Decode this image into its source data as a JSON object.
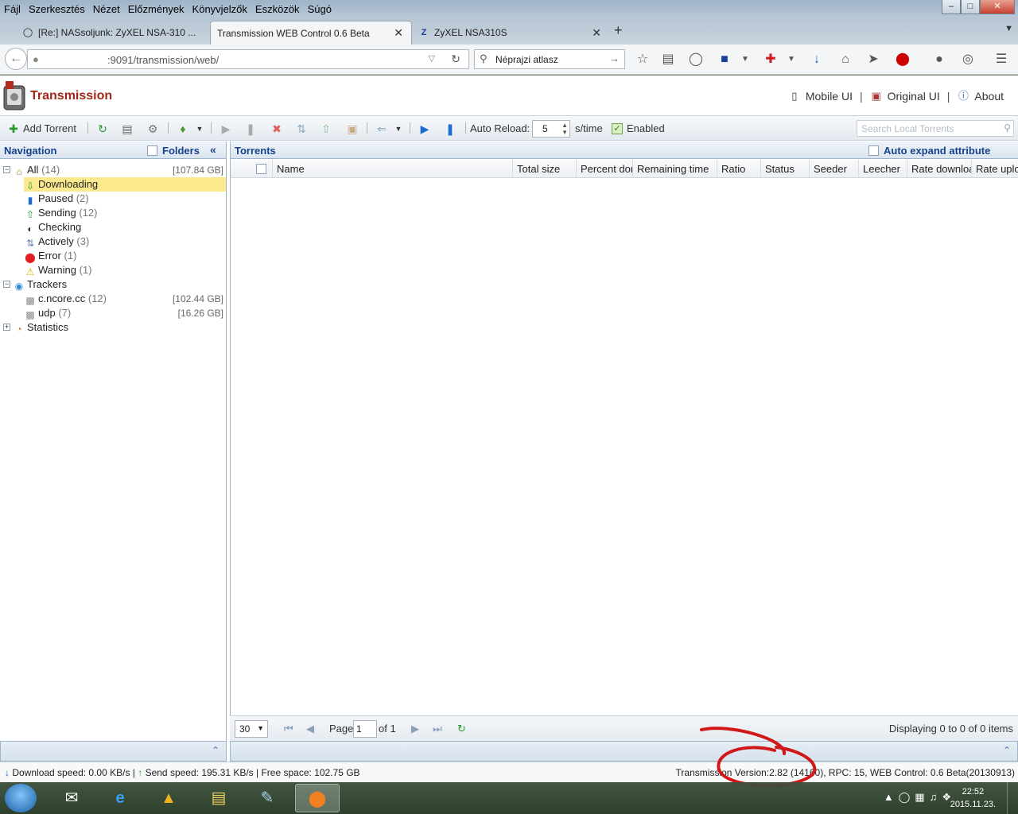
{
  "menu": [
    "Fájl",
    "Szerkesztés",
    "Nézet",
    "Előzmények",
    "Könyvjelzők",
    "Eszközök",
    "Súgó"
  ],
  "tabs": [
    {
      "label": "[Re:] NASsoljunk: ZyXEL NSA-310 ...",
      "icon": "chat-icon"
    },
    {
      "label": "Transmission WEB Control 0.6 Beta",
      "icon": ""
    },
    {
      "label": "ZyXEL NSA310S",
      "icon": "zyxel-icon"
    }
  ],
  "address": {
    "url": ":9091/transmission/web/"
  },
  "search": {
    "query": "Néprajzi atlasz"
  },
  "app": {
    "title": "Transmission"
  },
  "header_links": {
    "mobile": "Mobile UI",
    "original": "Original UI",
    "about": "About"
  },
  "toolbar": {
    "add_torrent": "Add Torrent",
    "auto_reload_label": "Auto Reload:",
    "auto_reload_value": "5",
    "auto_reload_unit": "s/time",
    "enabled_label": "Enabled",
    "search_placeholder": "Search Local Torrents"
  },
  "nav": {
    "title": "Navigation",
    "folders_label": "Folders",
    "all": {
      "label": "All",
      "count": "(14)",
      "size": "[107.84 GB]"
    },
    "items": [
      {
        "label": "Downloading",
        "count": ""
      },
      {
        "label": "Paused",
        "count": "(2)"
      },
      {
        "label": "Sending",
        "count": "(12)"
      },
      {
        "label": "Checking",
        "count": ""
      },
      {
        "label": "Actively",
        "count": "(3)"
      },
      {
        "label": "Error",
        "count": "(1)"
      },
      {
        "label": "Warning",
        "count": "(1)"
      }
    ],
    "trackers": {
      "label": "Trackers"
    },
    "tracker_items": [
      {
        "label": "c.ncore.cc",
        "count": "(12)",
        "size": "[102.44 GB]"
      },
      {
        "label": "udp",
        "count": "(7)",
        "size": "[16.26 GB]"
      }
    ],
    "statistics": {
      "label": "Statistics"
    }
  },
  "torrents": {
    "title": "Torrents",
    "auto_expand_label": "Auto expand attribute",
    "columns": [
      "Name",
      "Total size",
      "Percent done",
      "Remaining time",
      "Ratio",
      "Status",
      "Seeder",
      "Leecher",
      "Rate download",
      "Rate upload"
    ]
  },
  "pager": {
    "page_size": "30",
    "page_label": "Page",
    "page_value": "1",
    "of_label": "of 1",
    "displaying": "Displaying 0 to 0 of 0 items"
  },
  "status": {
    "left": "Download speed: 0.00 KB/s | ",
    "send": "Send speed: 195.31 KB/s | Free space: 102.75 GB",
    "right": "Transmission Version:2.82 (14160), RPC: 15, WEB Control: 0.6 Beta(20130913)"
  },
  "taskbar": {
    "time": "22:52",
    "date": "2015.11.23."
  }
}
